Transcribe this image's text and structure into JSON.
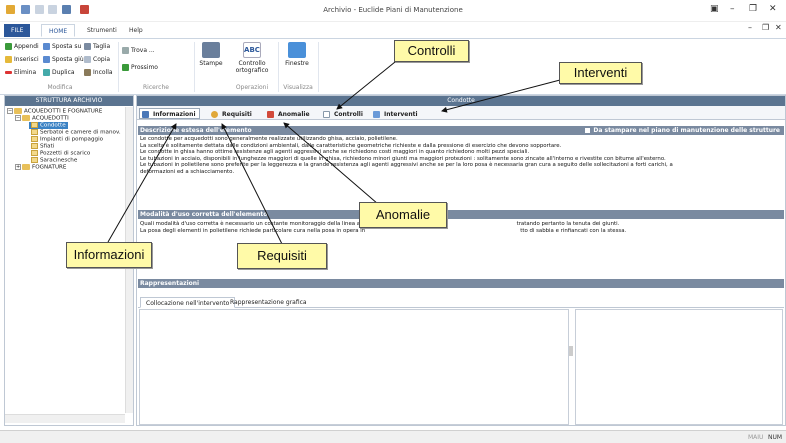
{
  "window": {
    "title": "Archivio - Euclide Piani di Manutenzione"
  },
  "tabs": [
    {
      "label": "FILE"
    },
    {
      "label": "HOME"
    },
    {
      "label": "Strumenti"
    },
    {
      "label": "Help"
    }
  ],
  "ribbon": {
    "modifica": {
      "appendi": "Appendi",
      "inserisci": "Inserisci",
      "elimina": "Elimina",
      "sposta_su": "Sposta su",
      "sposta_giu": "Sposta giù",
      "duplica": "Duplica",
      "taglia": "Taglia",
      "copia": "Copia",
      "incolla": "Incolla",
      "label": "Modifica"
    },
    "ricerche": {
      "trova": "Trova ...",
      "prossimo": "Prossimo",
      "label": "Ricerche"
    },
    "stampe": {
      "label": "Stampe"
    },
    "operazioni": {
      "controllo": "Controllo",
      "ortografico": "ortografico",
      "label": "Operazioni"
    },
    "visualizza": {
      "finestre": "Finestre",
      "label": "Visualizza"
    }
  },
  "left_panel": {
    "header": "STRUTTURA ARCHIVIO",
    "tree": [
      {
        "label": "ACQUEDOTTI E FOGNATURE"
      },
      {
        "label": "ACQUEDOTTI"
      },
      {
        "label": "Condotte"
      },
      {
        "label": "Serbatoi e camere di manov."
      },
      {
        "label": "Impianti di pompaggio"
      },
      {
        "label": "Sfiati"
      },
      {
        "label": "Pozzetti di scarico"
      },
      {
        "label": "Saracinesche"
      },
      {
        "label": "FOGNATURE"
      }
    ]
  },
  "main": {
    "header": "Condotte",
    "subtabs": [
      {
        "label": "Informazioni"
      },
      {
        "label": "Requisiti"
      },
      {
        "label": "Anomalie"
      },
      {
        "label": "Controlli"
      },
      {
        "label": "Interventi"
      }
    ],
    "section1": {
      "title": "Descrizione estesa dell'elemento",
      "checkbox": "Da stampare nel piano di manutenzione delle strutture",
      "lines": [
        "Le condotte per acquedotti sono generalmente realizzate utilizzando ghisa, acciaio, polietilene.",
        "La scelta è solitamente dettata dalle condizioni ambientali, dalle caratteristiche geometriche richieste e dalla pressione di esercizio che devono sopportare.",
        "Le condotte in ghisa hanno ottime resistenze agli agenti aggressivi anche se richiedono costi maggiori in quanto richiedono molti pezzi speciali.",
        "Le tubazioni in acciaio, disponibili in lunghezze maggiori di quelle in ghisa, richiedono minori giunti ma maggiori protezioni : solitamente sono zincate all'interno e rivestite con bitume all'esterno.",
        "Le tubazioni in polietilene sono preferite per la leggerezza e la grande resistenza agli agenti aggressivi anche se per la loro posa è necessaria gran cura a seguito delle sollecitazioni a forti carichi, a",
        "deformazioni ed a schiacciamento."
      ]
    },
    "section2": {
      "title": "Modalità d'uso corretta dell'elemento",
      "line1a": "Quali modalità d'uso corretta è necessario un costante monitoraggio della linea al",
      "line1b": "tratando pertanto la tenuta dei giunti.",
      "line2a": "La posa degli elementi in polietilene richiede particolare cura nella posa in opera in",
      "line2b": "tto di sabbia e rinfiancati con la stessa."
    },
    "section3": {
      "title": "Rappresentazioni"
    },
    "bottom_tabs": [
      {
        "label": "Collocazione nell'intervento"
      },
      {
        "label": "Rappresentazione grafica"
      }
    ]
  },
  "status": {
    "caps": "MAIU",
    "num": "NUM"
  },
  "callouts": {
    "controlli": "Controlli",
    "interventi": "Interventi",
    "anomalie": "Anomalie",
    "informazioni": "Informazioni",
    "requisiti": "Requisiti"
  }
}
